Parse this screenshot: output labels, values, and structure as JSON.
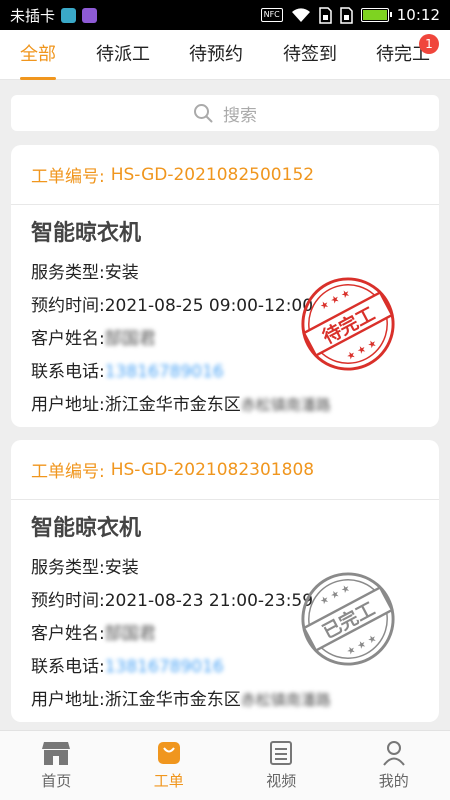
{
  "status_bar": {
    "carrier": "未插卡",
    "nfc": "NFC",
    "time": "10:12"
  },
  "tabs": [
    {
      "label": "全部",
      "active": true
    },
    {
      "label": "待派工",
      "active": false
    },
    {
      "label": "待预约",
      "active": false
    },
    {
      "label": "待签到",
      "active": false
    },
    {
      "label": "待完工",
      "active": false,
      "badge": "1"
    }
  ],
  "search": {
    "placeholder": "搜索",
    "icon": "search-icon"
  },
  "orders": [
    {
      "number_label": "工单编号:",
      "number": "HS-GD-2021082500152",
      "product": "智能晾衣机",
      "service_type_label": "服务类型:",
      "service_type": "安装",
      "appointment_label": "预约时间:",
      "appointment": "2021-08-25 09:00-12:00",
      "customer_label": "客户姓名:",
      "customer": "郜国君",
      "phone_label": "联系电话:",
      "phone": "13816789016",
      "address_label": "用户地址:",
      "address_visible": "浙江金华市金东区",
      "address_blurred": "赤松镇南潘路",
      "stamp_text": "待完工",
      "stamp_color": "#d9302a"
    },
    {
      "number_label": "工单编号:",
      "number": "HS-GD-2021082301808",
      "product": "智能晾衣机",
      "service_type_label": "服务类型:",
      "service_type": "安装",
      "appointment_label": "预约时间:",
      "appointment": "2021-08-23 21:00-23:59",
      "customer_label": "客户姓名:",
      "customer": "郜国君",
      "phone_label": "联系电话:",
      "phone": "13816789016",
      "address_label": "用户地址:",
      "address_visible": "浙江金华市金东区",
      "address_blurred": "赤松镇南潘路",
      "stamp_text": "已完工",
      "stamp_color": "#8a8a8a"
    }
  ],
  "bottom_nav": [
    {
      "label": "首页",
      "icon": "shop-icon",
      "active": false
    },
    {
      "label": "工单",
      "icon": "bag-icon",
      "active": true
    },
    {
      "label": "视频",
      "icon": "video-icon",
      "active": false
    },
    {
      "label": "我的",
      "icon": "user-icon",
      "active": false
    }
  ],
  "colors": {
    "accent": "#f0961e",
    "badge": "#f0463c",
    "background": "#eeeeee"
  }
}
